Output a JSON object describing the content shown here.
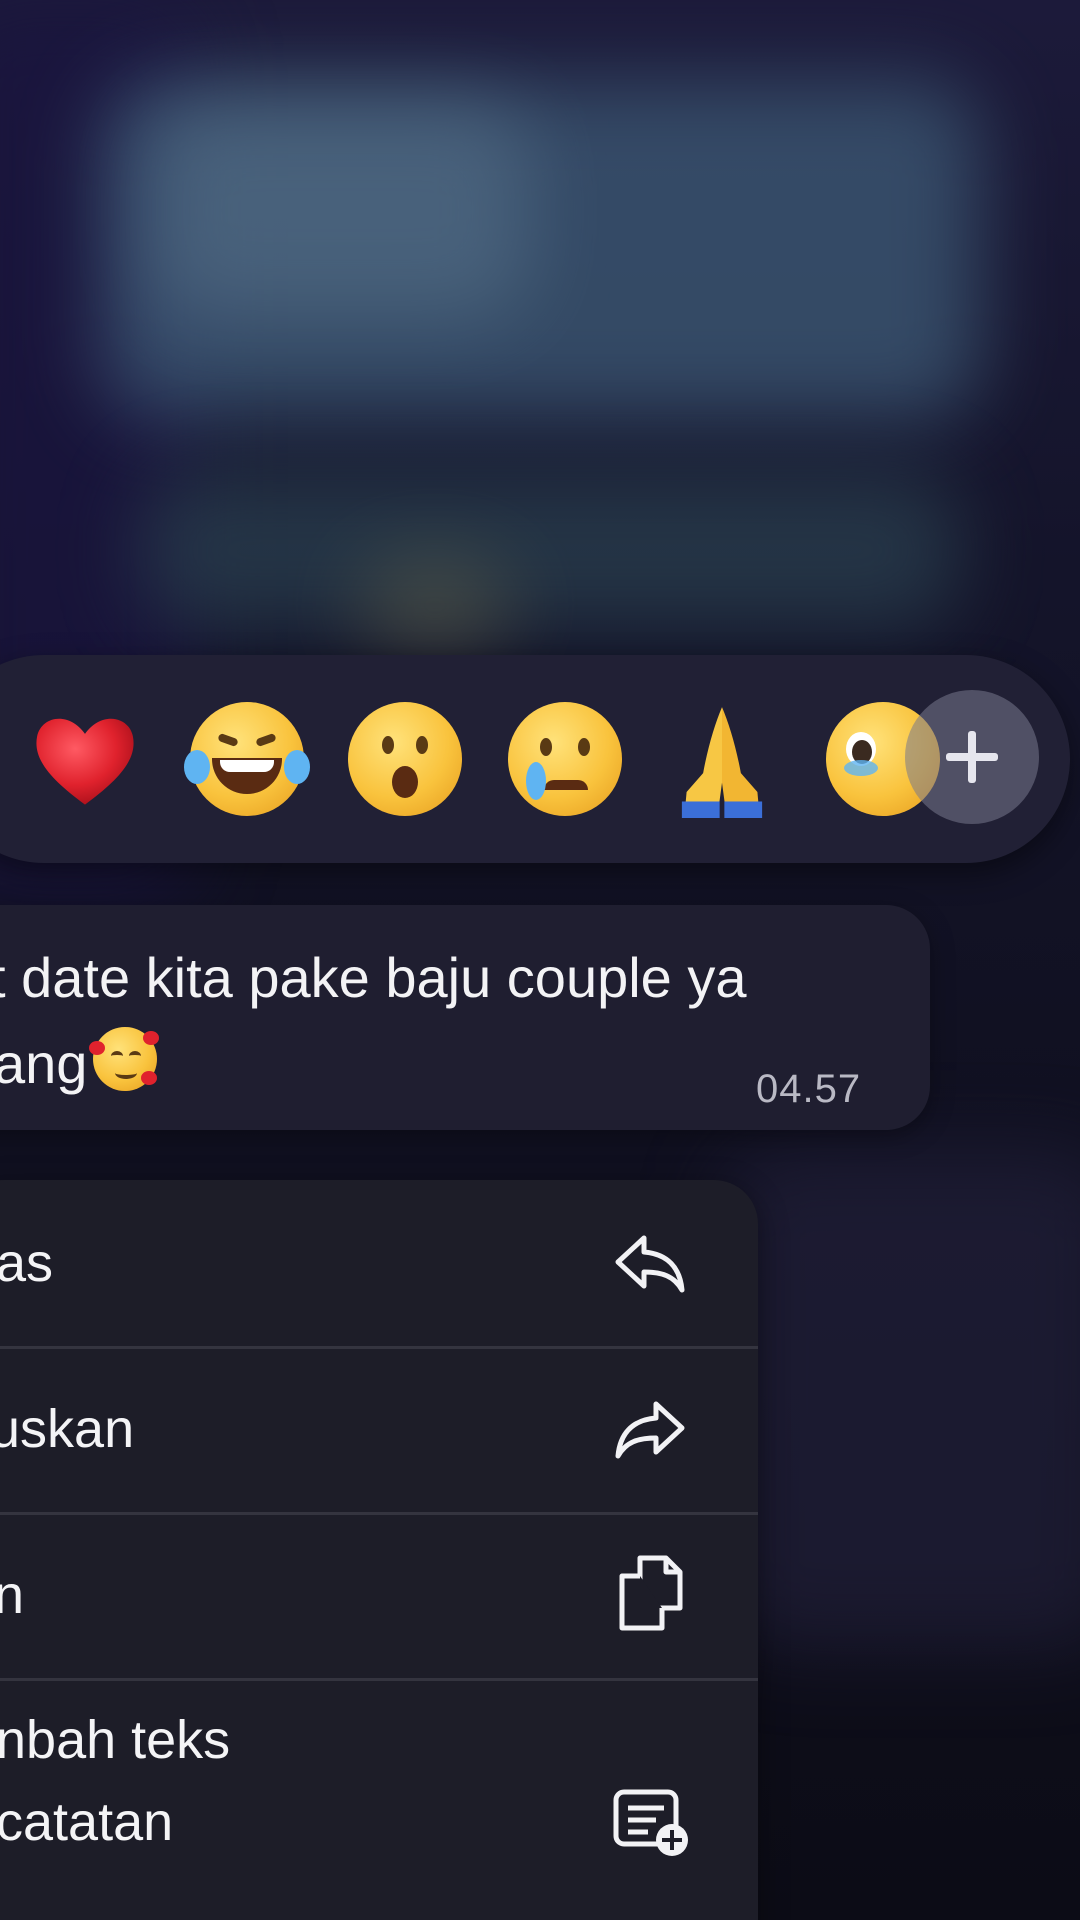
{
  "reactions": {
    "items": [
      {
        "name": "heart",
        "glyph": "❤"
      },
      {
        "name": "laughing-tears",
        "glyph": "😂"
      },
      {
        "name": "surprised",
        "glyph": "😮"
      },
      {
        "name": "crying",
        "glyph": "😢"
      },
      {
        "name": "folded-hands",
        "glyph": "🙏"
      },
      {
        "name": "pleading",
        "glyph": "🥹"
      }
    ],
    "more_icon": "plus-icon"
  },
  "message": {
    "line1": "t date kita pake baju couple ya",
    "line2": "ang",
    "trailing_emoji": "smiling-face-with-hearts",
    "time": "04.57"
  },
  "menu": {
    "items": [
      {
        "label": "as",
        "icon": "reply-icon"
      },
      {
        "label": "uskan",
        "icon": "forward-icon"
      },
      {
        "label": "n",
        "icon": "copy-icon"
      },
      {
        "label_line1": "nbah teks",
        "label_line2": "catatan",
        "icon": "add-note-icon"
      }
    ]
  },
  "colors": {
    "panel": "#1d1d28",
    "bubble": "#1f1e30",
    "reaction_bar": "#212035",
    "text": "#f4f4f6",
    "time_text": "#b9b9c4",
    "heart": "#e0222d"
  }
}
